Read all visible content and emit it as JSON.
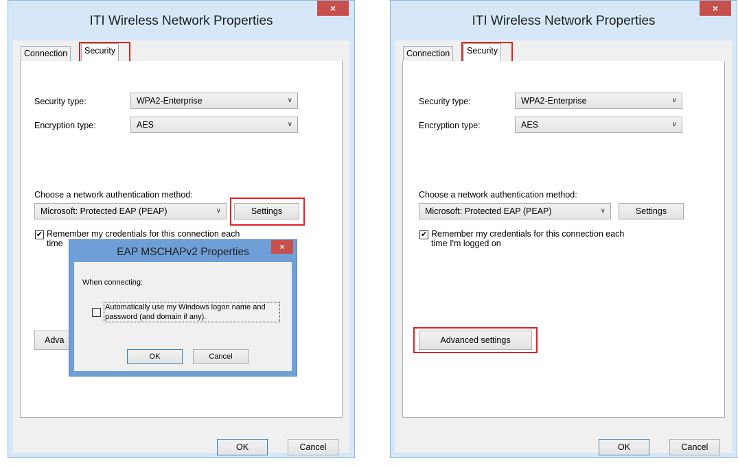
{
  "window_left": {
    "title": "ITI Wireless Network Properties",
    "close": "×",
    "tabs": [
      "Connection",
      "Security"
    ],
    "security_type_label": "Security type:",
    "security_type_value": "WPA2-Enterprise",
    "encryption_type_label": "Encryption type:",
    "encryption_type_value": "AES",
    "auth_method_label": "Choose a network authentication method:",
    "auth_method_value": "Microsoft: Protected EAP (PEAP)",
    "settings_label": "Settings",
    "remember_line1": "Remember my credentials for this connection each",
    "remember_line2_partial": "time",
    "advanced_partial": "Adva",
    "ok_label": "OK",
    "cancel_label": "Cancel"
  },
  "dialog": {
    "title": "EAP MSCHAPv2 Properties",
    "close": "×",
    "when_connecting": "When connecting:",
    "auto_line1": "Automatically use my Windows logon name and",
    "auto_line2": "password (and domain if any).",
    "ok_label": "OK",
    "cancel_label": "Cancel"
  },
  "window_right": {
    "title": "ITI Wireless Network Properties",
    "close": "×",
    "tabs": [
      "Connection",
      "Security"
    ],
    "security_type_label": "Security type:",
    "security_type_value": "WPA2-Enterprise",
    "encryption_type_label": "Encryption type:",
    "encryption_type_value": "AES",
    "auth_method_label": "Choose a network authentication method:",
    "auth_method_value": "Microsoft: Protected EAP (PEAP)",
    "settings_label": "Settings",
    "remember_line1": "Remember my credentials for this connection each",
    "remember_line2": "time I'm logged on",
    "advanced_label": "Advanced settings",
    "ok_label": "OK",
    "cancel_label": "Cancel"
  },
  "icons": {
    "dropdown": "chevron-down-icon",
    "check": "checkmark-icon",
    "close": "close-icon"
  },
  "colors": {
    "highlight": "#e02020",
    "close_button": "#c7504c",
    "window_frame": "#d6e8f7",
    "dialog_frame": "#6e9fd6"
  }
}
